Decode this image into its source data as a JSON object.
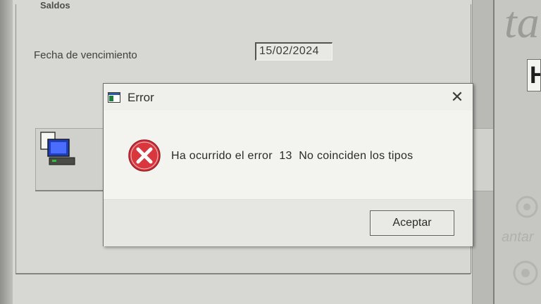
{
  "window": {
    "group_title": "Saldos",
    "fecha_label": "Fecha de vencimiento",
    "fecha_value": "15/02/2024",
    "right_letter": "ta",
    "right_button_text": "H",
    "right_watermark": "antar"
  },
  "dialog": {
    "title": "Error",
    "close_glyph": "✕",
    "message": "Ha ocurrido el error  13  No coinciden los tipos",
    "ok_label": "Aceptar"
  },
  "icons": {
    "app": "app-window-icon",
    "error": "error-x-icon",
    "computer": "computer-terminal-icon",
    "close": "close-icon"
  },
  "colors": {
    "error_red": "#d9363e",
    "dialog_bg": "#f0f0ed"
  }
}
